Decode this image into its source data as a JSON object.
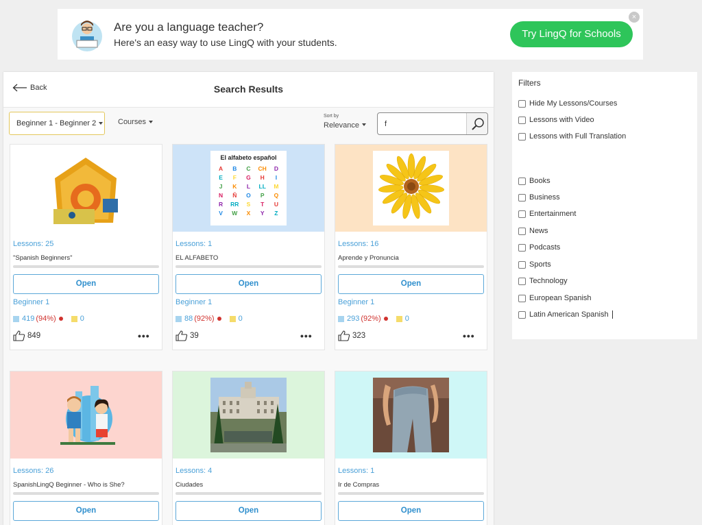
{
  "banner": {
    "line1": "Are you a language teacher?",
    "line2": "Here's an easy way to use LingQ with your students.",
    "cta": "Try LingQ for Schools",
    "close": "×"
  },
  "header": {
    "back": "Back",
    "title": "Search Results"
  },
  "toolbar": {
    "level": "Beginner 1 - Beginner 2",
    "courses": "Courses",
    "sort_label": "Sort by",
    "sort_value": "Relevance",
    "search_value": "f"
  },
  "cards": [
    {
      "lessons": "Lessons: 25",
      "title": "\"Spanish Beginners\"",
      "open": "Open",
      "level": "Beginner 1",
      "known": "419",
      "pct": "(94%)",
      "lingqs": "0",
      "likes": "849",
      "more": "•••",
      "bg": "#ffffff"
    },
    {
      "lessons": "Lessons: 1",
      "title": "EL ALFABETO",
      "open": "Open",
      "level": "Beginner 1",
      "known": "88",
      "pct": "(92%)",
      "lingqs": "0",
      "likes": "39",
      "more": "•••",
      "bg": "#cde3f8",
      "img_title": "El alfabeto español",
      "letters": [
        "A",
        "B",
        "C",
        "CH",
        "D",
        "E",
        "F",
        "G",
        "H",
        "I",
        "J",
        "K",
        "L",
        "LL",
        "M",
        "N",
        "Ñ",
        "O",
        "P",
        "Q",
        "R",
        "RR",
        "S",
        "T",
        "U",
        "V",
        "W",
        "X",
        "Y",
        "Z"
      ]
    },
    {
      "lessons": "Lessons: 16",
      "title": "Aprende y Pronuncia",
      "open": "Open",
      "level": "Beginner 1",
      "known": "293",
      "pct": "(92%)",
      "lingqs": "0",
      "likes": "323",
      "more": "•••",
      "bg": "#fde3c4"
    },
    {
      "lessons": "Lessons: 26",
      "title": "SpanishLingQ Beginner - Who is She?",
      "open": "Open",
      "bg": "#fdd5cf"
    },
    {
      "lessons": "Lessons: 4",
      "title": "Ciudades",
      "open": "Open",
      "bg": "#dcf5dc"
    },
    {
      "lessons": "Lessons: 1",
      "title": "Ir de Compras",
      "open": "Open",
      "bg": "#cff7f7"
    }
  ],
  "filters": {
    "title": "Filters",
    "options": [
      "Hide My Lessons/Courses",
      "Lessons with Video",
      "Lessons with Full Translation"
    ],
    "categories": [
      "Books",
      "Business",
      "Entertainment",
      "News",
      "Podcasts",
      "Sports",
      "Technology",
      "European Spanish",
      "Latin American Spanish"
    ]
  },
  "colors": {
    "accent_blue": "#4aa0d8",
    "cta_green": "#2ec55a",
    "warning_red": "#d0322e"
  },
  "icons": {
    "back": "arrow-left-icon",
    "search": "magnifier-icon",
    "like": "thumbs-up-icon",
    "more": "ellipsis-icon"
  }
}
